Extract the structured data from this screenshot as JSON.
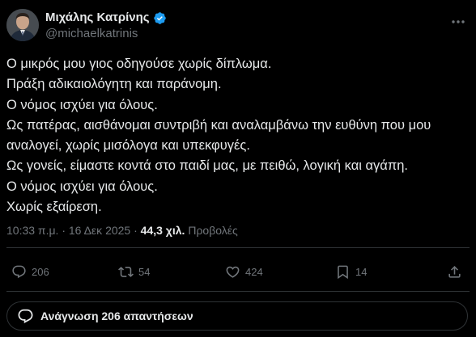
{
  "author": {
    "display_name": "Μιχάλης Κατρίνης",
    "handle": "@michaelkatrinis",
    "verified_color": "#1d9bf0"
  },
  "tweet": {
    "lines": [
      "Ο μικρός μου γιος οδηγούσε χωρίς δίπλωμα.",
      "Πράξη αδικαιολόγητη και παράνομη.",
      "Ο νόμος ισχύει για όλους.",
      "Ως πατέρας, αισθάνομαι συντριβή και αναλαμβάνω την ευθύνη που μου",
      "αναλογεί, χωρίς μισόλογα και υπεκφυγές.",
      "Ως γονείς, είμαστε κοντά στο παιδί μας, με πειθώ, λογική και αγάπη.",
      "Ο νόμος ισχύει για όλους.",
      "Χωρίς εξαίρεση."
    ]
  },
  "meta": {
    "time": "10:33 π.μ.",
    "separator": "·",
    "date": "16 Δεκ 2025",
    "views_count": "44,3 χιλ.",
    "views_label": "Προβολές"
  },
  "actions": {
    "replies": "206",
    "reposts": "54",
    "likes": "424",
    "bookmarks": "14"
  },
  "read_replies": {
    "label": "Ανάγνωση 206 απαντήσεων"
  },
  "icons": {
    "more": "more-horizontal-icon",
    "reply": "reply-icon",
    "repost": "repost-icon",
    "like": "heart-icon",
    "bookmark": "bookmark-icon",
    "share": "share-icon",
    "verified": "verified-badge-icon"
  },
  "colors": {
    "background": "#000000",
    "text": "#e7e9ea",
    "muted": "#71767b",
    "border": "#2f3336",
    "verified": "#1d9bf0"
  }
}
